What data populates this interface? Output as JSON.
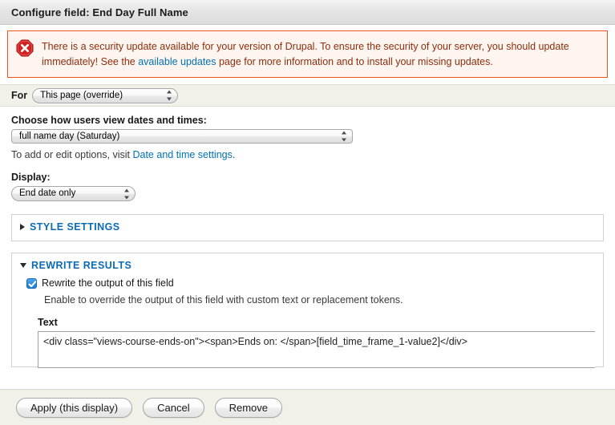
{
  "window": {
    "title": "Configure field: End Day Full Name"
  },
  "message": {
    "icon": "error-octagon-icon",
    "text_part1": "There is a security update available for your version of Drupal. To ensure the security of your server, you should update immediately! See the ",
    "link_text": "available updates",
    "text_part2": " page for more information and to install your missing updates.",
    "border_color": "#ed541d",
    "background_color": "#fef5f1",
    "text_color": "#8c2e0b",
    "link_color": "#0071b3"
  },
  "for_row": {
    "label": "For",
    "selected": "This page (override)"
  },
  "date_format": {
    "label": "Choose how users view dates and times:",
    "selected": "full name day (Saturday)",
    "help_prefix": "To add or edit options, visit ",
    "help_link": "Date and time settings",
    "help_suffix": "."
  },
  "display": {
    "label": "Display:",
    "selected": "End date only"
  },
  "style_settings": {
    "legend": "STYLE SETTINGS",
    "state": "collapsed"
  },
  "rewrite_results": {
    "legend": "REWRITE RESULTS",
    "state": "expanded",
    "checkbox_label": "Rewrite the output of this field",
    "checkbox_checked": true,
    "checkbox_description": "Enable to override the output of this field with custom text or replacement tokens.",
    "text_label": "Text",
    "text_value": "<div class=\"views-course-ends-on\"><span>Ends on: </span>[field_time_frame_1-value2]</div>"
  },
  "footer": {
    "apply_label": "Apply (this display)",
    "cancel_label": "Cancel",
    "remove_label": "Remove"
  }
}
